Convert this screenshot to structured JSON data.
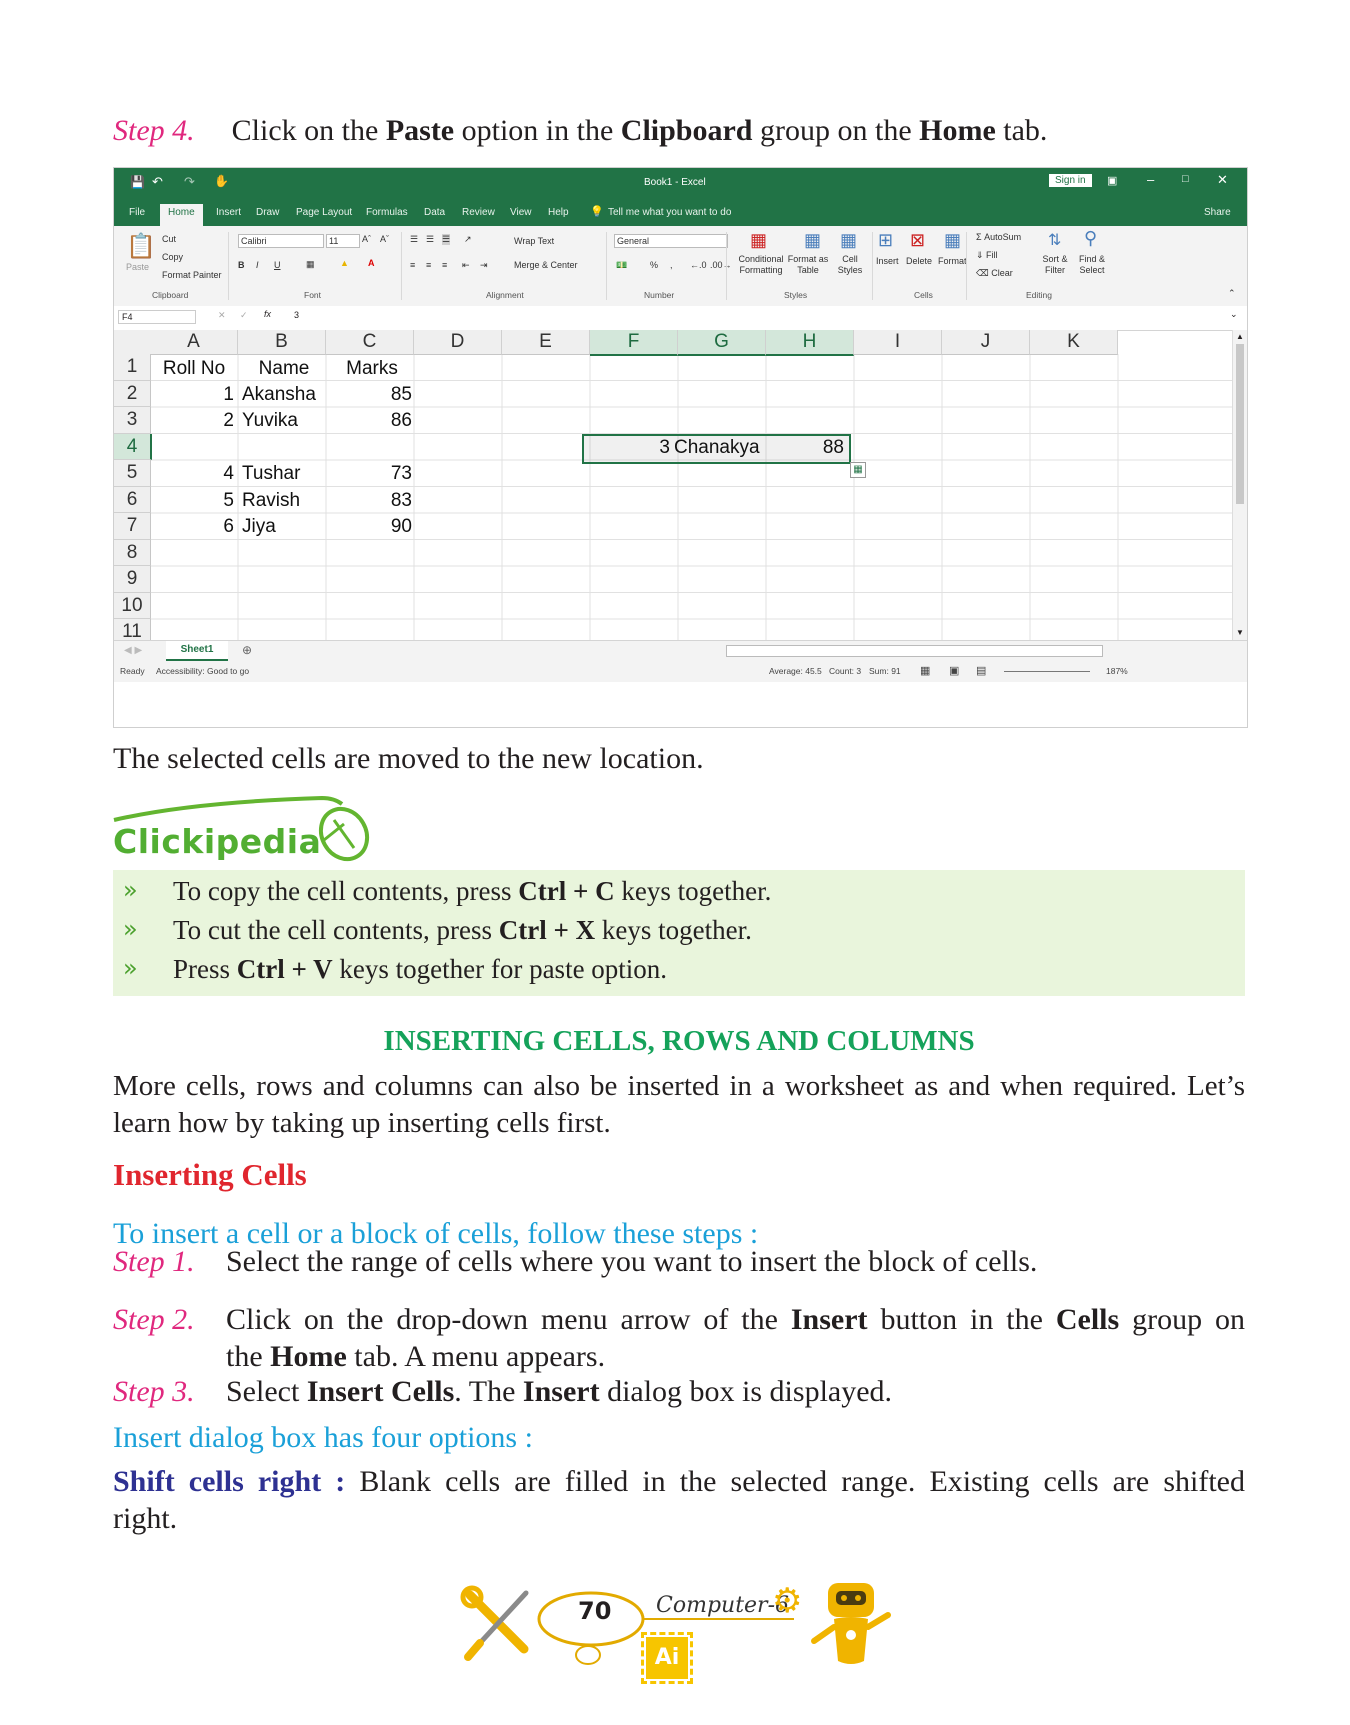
{
  "step4": {
    "label": "Step 4.",
    "t1": "Click on the ",
    "b1": "Paste",
    "t2": " option in the ",
    "b2": "Clipboard",
    "t3": " group on the ",
    "b3": "Home",
    "t4": " tab."
  },
  "excel": {
    "title": "Book1  -  Excel",
    "sign_in": "Sign in",
    "tabs": [
      "File",
      "Home",
      "Insert",
      "Draw",
      "Page Layout",
      "Formulas",
      "Data",
      "Review",
      "View",
      "Help"
    ],
    "tell_me": "Tell me what you want to do",
    "share": "Share",
    "clipboard": {
      "paste": "Paste",
      "cut": "Cut",
      "copy": "Copy",
      "format_painter": "Format Painter",
      "group": "Clipboard"
    },
    "font": {
      "name": "Calibri",
      "size": "11",
      "bold": "B",
      "italic": "I",
      "underline": "U",
      "group": "Font"
    },
    "alignment": {
      "wrap": "Wrap Text",
      "merge": "Merge & Center",
      "group": "Alignment"
    },
    "number": {
      "format": "General",
      "percent": "%",
      "comma": ",",
      "group": "Number"
    },
    "styles": {
      "conditional": "Conditional Formatting",
      "format_table": "Format as Table",
      "cell_styles": "Cell Styles",
      "group": "Styles"
    },
    "cells": {
      "insert": "Insert",
      "delete": "Delete",
      "format": "Format",
      "group": "Cells"
    },
    "editing": {
      "autosum": "AutoSum",
      "fill": "Fill",
      "clear": "Clear",
      "sort": "Sort & Filter",
      "find": "Find & Select",
      "group": "Editing"
    },
    "name_box": "F4",
    "fx": "fx",
    "formula": "3",
    "columns": [
      "A",
      "B",
      "C",
      "D",
      "E",
      "F",
      "G",
      "H",
      "I",
      "J",
      "K"
    ],
    "rows": [
      "1",
      "2",
      "3",
      "4",
      "5",
      "6",
      "7",
      "8",
      "9",
      "10",
      "11"
    ],
    "headers": {
      "a": "Roll No",
      "b": "Name",
      "c": "Marks"
    },
    "data": [
      {
        "roll": "1",
        "name": "Akansha",
        "marks": "85"
      },
      {
        "roll": "2",
        "name": "Yuvika",
        "marks": "86"
      },
      {
        "roll": "4",
        "name": "Tushar",
        "marks": "73"
      },
      {
        "roll": "5",
        "name": "Ravish",
        "marks": "83"
      },
      {
        "roll": "6",
        "name": "Jiya",
        "marks": "90"
      }
    ],
    "moved": {
      "roll": "3",
      "name": "Chanakya",
      "marks": "88"
    },
    "sheet_tab": "Sheet1",
    "status": {
      "ready": "Ready",
      "accessibility": "Accessibility: Good to go",
      "average": "Average: 45.5",
      "count": "Count: 3",
      "sum": "Sum: 91",
      "zoom": "187%"
    }
  },
  "moved_text": "The selected cells are moved to the new location.",
  "clickipedia": {
    "title": "Clickipedia",
    "items": [
      {
        "t1": "To copy the cell contents, press ",
        "b": "Ctrl + C",
        "t2": " keys together."
      },
      {
        "t1": "To cut the cell contents, press ",
        "b": "Ctrl + X",
        "t2": " keys together."
      },
      {
        "t1": "Press ",
        "b": "Ctrl + V",
        "t2": " keys together for paste option."
      }
    ]
  },
  "section_heading": "INSERTING CELLS, ROWS AND COLUMNS",
  "intro": "More cells, rows and columns can also be inserted in a worksheet as and when required. Let’s learn how by taking up inserting cells first.",
  "inserting_cells_heading": "Inserting Cells",
  "steps_intro": "To insert a cell or a block of cells, follow these steps :",
  "steps": [
    {
      "label": "Step 1.",
      "t1": "Select the range of cells where you want to insert the block of cells."
    },
    {
      "label": "Step 2.",
      "t1": "Click on the drop-down menu arrow of the ",
      "b1": "Insert",
      "t2": " button in the ",
      "b2": "Cells",
      "t3": " group on",
      "t4": "the ",
      "b3": "Home",
      "t5": " tab. A menu appears."
    },
    {
      "label": "Step 3.",
      "t1": "Select ",
      "b1": "Insert Cells",
      "t2": ". The ",
      "b2": "Insert",
      "t3": " dialog box is displayed."
    }
  ],
  "options_intro": "Insert dialog box has four options :",
  "shift_right": {
    "label": "Shift cells right :",
    "text": " Blank cells are filled in the selected range. Existing cells are shifted",
    "text2": "right."
  },
  "footer": {
    "page": "70",
    "book": "Computer-6",
    "badge": "Ai"
  }
}
